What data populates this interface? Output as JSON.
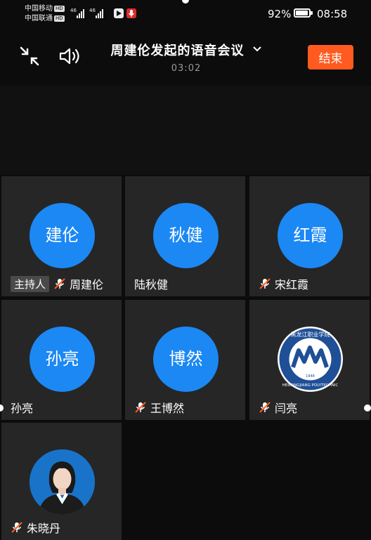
{
  "status_bar": {
    "carrier1": "中国移动",
    "carrier2": "中国联通",
    "hd": "HD",
    "net": "46",
    "battery_percent": "92%",
    "battery_level": 0.92,
    "time": "08:58"
  },
  "header": {
    "title": "周建伦发起的语音会议",
    "timer": "03:02",
    "end_label": "结束"
  },
  "participants": [
    {
      "avatar_text": "建伦",
      "name": "周建伦",
      "host_label": "主持人",
      "muted": true
    },
    {
      "avatar_text": "秋健",
      "name": "陆秋健",
      "muted": false
    },
    {
      "avatar_text": "红霞",
      "name": "宋红霞",
      "muted": true
    },
    {
      "avatar_text": "孙亮",
      "name": "孙亮",
      "muted": false
    },
    {
      "avatar_text": "博然",
      "name": "王博然",
      "muted": true
    },
    {
      "avatar_text": "",
      "name": "闫亮",
      "muted": true,
      "avatar_image": "school-logo"
    },
    {
      "avatar_text": "",
      "name": "朱晓丹",
      "muted": true,
      "avatar_image": "profile-photo"
    }
  ],
  "logo_text": {
    "top": "黑龙江职业学院",
    "bottom": "HEILONGJIANG POLYTECHNIC",
    "year": "1948"
  },
  "colors": {
    "accent_blue": "#1b88f4",
    "end_orange": "#ff5a1f",
    "tile_bg": "#262626"
  }
}
